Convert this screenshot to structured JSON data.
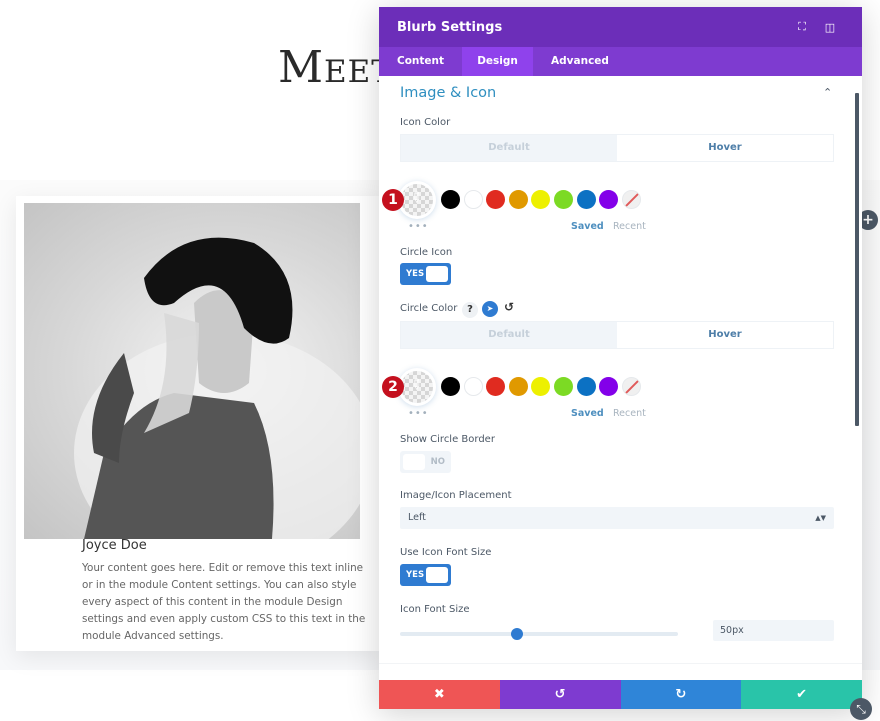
{
  "page": {
    "heading": "Meet",
    "card": {
      "name": "Joyce Doe",
      "body": "Your content goes here. Edit or remove this text inline or in the module Content settings. You can also style every aspect of this content in the module Design settings and even apply custom CSS to this text in the module Advanced settings."
    },
    "add_row_icon": "+",
    "resize_icon": "⤡"
  },
  "modal": {
    "title": "Blurb Settings",
    "header_icons": {
      "fullscreen": "⛶",
      "split": "◫"
    },
    "tabs": [
      {
        "label": "Content",
        "active": false
      },
      {
        "label": "Design",
        "active": true
      },
      {
        "label": "Advanced",
        "active": false
      }
    ],
    "section": {
      "title": "Image & Icon",
      "collapse_icon": "⌃"
    },
    "icon_color": {
      "label": "Icon Color",
      "modes": {
        "default": "Default",
        "hover": "Hover",
        "active": "Hover"
      },
      "step_badge": "1"
    },
    "circle_icon": {
      "label": "Circle Icon",
      "value": "YES",
      "enabled": true
    },
    "circle_color": {
      "label": "Circle Color",
      "help_icon": "?",
      "hover_icon": "➤",
      "reset_icon": "↺",
      "modes": {
        "default": "Default",
        "hover": "Hover",
        "active": "Hover"
      },
      "step_badge": "2"
    },
    "swatches": [
      "#000000",
      "#ffffff",
      "#e02b20",
      "#e09900",
      "#edf000",
      "#7cda24",
      "#0c71c3",
      "#8300e9",
      "none"
    ],
    "palette_tabs": {
      "saved": "Saved",
      "recent": "Recent",
      "more": "•••"
    },
    "show_circle_border": {
      "label": "Show Circle Border",
      "value": "NO",
      "enabled": false
    },
    "placement": {
      "label": "Image/Icon Placement",
      "value": "Left",
      "arrows": "▲▼"
    },
    "use_icon_font_size": {
      "label": "Use Icon Font Size",
      "value": "YES",
      "enabled": true
    },
    "icon_font_size": {
      "label": "Icon Font Size",
      "value": "50px",
      "slider_fraction": 0.42
    },
    "footer": {
      "cancel": {
        "icon": "✖",
        "color": "#ef5555"
      },
      "undo": {
        "icon": "↺",
        "color": "#7e3bd0"
      },
      "redo": {
        "icon": "↻",
        "color": "#2f85d8"
      },
      "save": {
        "icon": "✔",
        "color": "#29c4a9"
      }
    },
    "colors": {
      "header": "#6c2eb9",
      "tabs": "#7e3bd0",
      "active_tab": "#8f42ec",
      "accent": "#2f7bd1",
      "section_title": "#2f8fc0"
    }
  }
}
